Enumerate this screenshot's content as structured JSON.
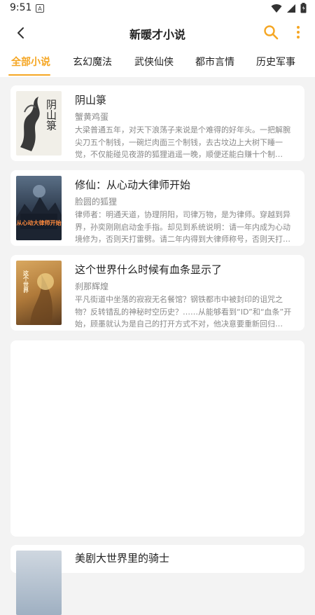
{
  "status": {
    "time": "9:51",
    "notif_glyph": "A"
  },
  "appbar": {
    "title": "新暖才小说",
    "back_icon": "back-arrow-icon",
    "search_icon": "search-icon",
    "more_icon": "more-vert-icon"
  },
  "colors": {
    "accent": "#f5a623",
    "text": "#222222",
    "muted": "#888888",
    "background": "#f3f3f3"
  },
  "tabs": [
    {
      "label": "全部小说",
      "active": true
    },
    {
      "label": "玄幻魔法",
      "active": false
    },
    {
      "label": "武侠仙侠",
      "active": false
    },
    {
      "label": "都市言情",
      "active": false
    },
    {
      "label": "历史军事",
      "active": false
    }
  ],
  "books": [
    {
      "title": "阴山箓",
      "author": "蟹黄鸡蛋",
      "desc": "大梁普通五年，对天下浪荡子来说是个难得的好年头。一把解腕尖刀五个制钱，一碗烂肉面三个制钱，去古坟边上大树下睡一觉，不仅能碰见夜游的狐狸逍遥一晚，顺便还能白赚十个制钱……",
      "cover_text": "阴山箓"
    },
    {
      "title": "修仙：从心动大律师开始",
      "author": "脸圆的狐狸",
      "desc": "律师者：明通天道，协理阴阳，司律万物，是为律师。穿越到异界，孙奕刚刚启动金手指。却见到系统说明：请一年内成为心动境修为，否则天打雷劈。请二年内得到大律师称号，否则天打雷劈……",
      "cover_text": "从心动大律师开始"
    },
    {
      "title": "这个世界什么时候有血条显示了",
      "author": "刹那辉煌",
      "desc": "平凡街道中坐落的寂寂无名餐馆？钢铁都市中被封印的诅咒之物？反转错乱的神秘时空历史？……从能够看到“ID”和“血条”开始，顾墨就认为是自己的打开方式不对，他决意要重新回归到……",
      "cover_text": "这个世界"
    },
    {
      "title": "美剧大世界里的骑士",
      "author": "",
      "desc": "",
      "cover_text": ""
    }
  ]
}
